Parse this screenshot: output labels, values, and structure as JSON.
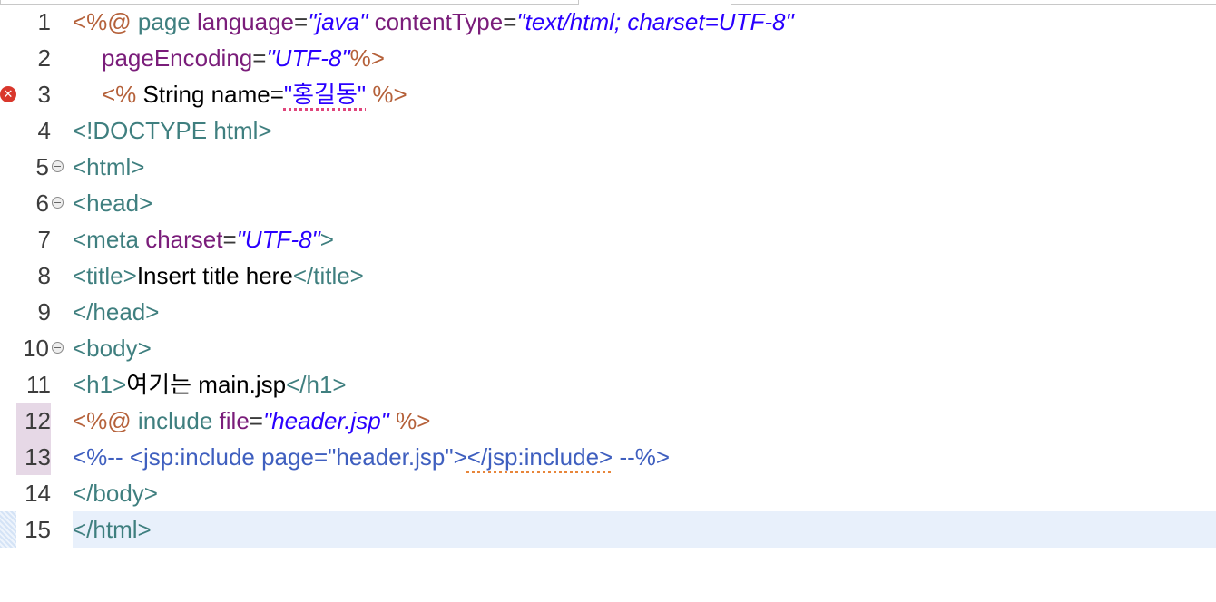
{
  "editor": {
    "language": "JSP",
    "lines": [
      {
        "num": "1",
        "parts": [
          "<%@ ",
          "page ",
          "language",
          "=",
          "\"java\"",
          " contentType",
          "=",
          "\"text/html; charset=UTF-8\""
        ]
      },
      {
        "num": "2",
        "parts": [
          "pageEncoding",
          "=",
          "\"UTF-8\"",
          "%>"
        ]
      },
      {
        "num": "3",
        "parts": [
          "<% ",
          "String name=",
          "\"홍길동\"",
          " %>"
        ],
        "marker": "error-icon"
      },
      {
        "num": "4",
        "parts": [
          "<!DOCTYPE html>"
        ]
      },
      {
        "num": "5",
        "parts": [
          "<html>"
        ],
        "fold": true
      },
      {
        "num": "6",
        "parts": [
          "<head>"
        ],
        "fold": true
      },
      {
        "num": "7",
        "parts": [
          "<meta ",
          "charset",
          "=",
          "\"UTF-8\"",
          ">"
        ]
      },
      {
        "num": "8",
        "parts": [
          "<title>",
          "Insert title here",
          "</title>"
        ]
      },
      {
        "num": "9",
        "parts": [
          "</head>"
        ]
      },
      {
        "num": "10",
        "parts": [
          "<body>"
        ],
        "fold": true
      },
      {
        "num": "11",
        "parts": [
          "<h1>",
          "여기는 main.jsp",
          "</h1>"
        ]
      },
      {
        "num": "12",
        "parts": [
          "<%@ ",
          "include ",
          "file",
          "=",
          "\"header.jsp\"",
          " %>"
        ],
        "changed": true
      },
      {
        "num": "13",
        "parts": [
          "<%-- <jsp:include page=\"header.jsp\">",
          "</jsp:include>",
          " --%>"
        ],
        "changed": true
      },
      {
        "num": "14",
        "parts": [
          "</body>"
        ]
      },
      {
        "num": "15",
        "parts": [
          "</html>"
        ],
        "current": true
      }
    ]
  },
  "colors": {
    "jsp_delimiter": "#b5613a",
    "attribute": "#7a1d7a",
    "string": "#2a00ff",
    "tag": "#3f7f7f",
    "comment": "#3f5fbf",
    "current_line": "#e8f0fb",
    "error": "#d9372c"
  }
}
